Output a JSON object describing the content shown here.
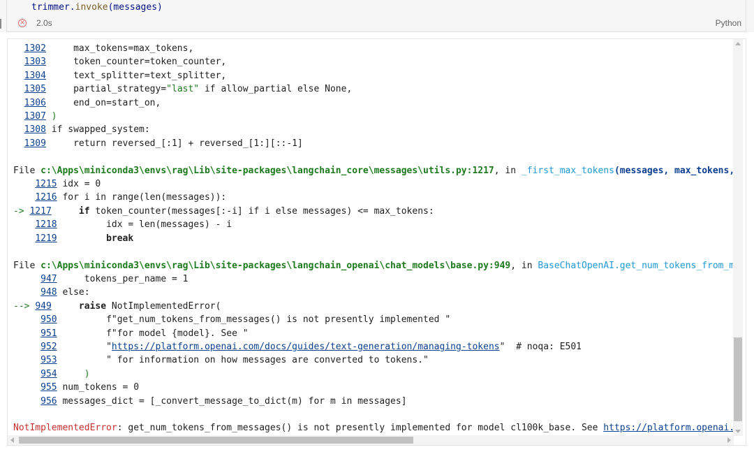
{
  "cell": {
    "code_obj": "trimmer",
    "code_dot": ".",
    "code_fn": "invoke",
    "code_open": "(",
    "code_arg": "messages",
    "code_close": ")",
    "status_icon": "error-circle-icon",
    "duration": "2.0s",
    "language": "Python"
  },
  "traceback": {
    "block1": [
      {
        "num": "1302",
        "code": "    max_tokens=max_tokens,"
      },
      {
        "num": "1303",
        "code": "    token_counter=token_counter,"
      },
      {
        "num": "1304",
        "code": "    text_splitter=text_splitter,"
      },
      {
        "num": "1305",
        "code_a": "    partial_strategy=",
        "str": "\"last\"",
        "code_b": " if allow_partial else None,"
      },
      {
        "num": "1306",
        "code": "    end_on=start_on,"
      },
      {
        "num": "1307",
        "code": ")"
      },
      {
        "num": "1308",
        "code": "if swapped_system:"
      },
      {
        "num": "1309",
        "code": "    return reversed_[:1] + reversed_[1:][::-1]"
      }
    ],
    "file2": {
      "prefix": "File ",
      "path": "c:\\Apps\\miniconda3\\envs\\rag\\Lib\\site-packages\\langchain_core\\messages\\utils.py:1217",
      "in": ", in ",
      "func": "_first_max_tokens",
      "args": "(messages, max_tokens,"
    },
    "block2": [
      {
        "arrow": "    ",
        "num": "1215",
        "code": "idx = 0"
      },
      {
        "arrow": "    ",
        "num": "1216",
        "code": "for i in range(len(messages)):"
      },
      {
        "arrow": "-> ",
        "num": "1217",
        "kw": "    if",
        "code": " token_counter(messages[:-i] if i else messages) <= max_tokens:"
      },
      {
        "arrow": "    ",
        "num": "1218",
        "code": "        idx = len(messages) - i"
      },
      {
        "arrow": "    ",
        "num": "1219",
        "code": "        break"
      }
    ],
    "file3": {
      "prefix": "File ",
      "path": "c:\\Apps\\miniconda3\\envs\\rag\\Lib\\site-packages\\langchain_openai\\chat_models\\base.py:949",
      "in": ", in ",
      "func": "BaseChatOpenAI.get_num_tokens_from_m"
    },
    "block3": [
      {
        "arrow": "     ",
        "num": "947",
        "code": "    tokens_per_name = 1"
      },
      {
        "arrow": "     ",
        "num": "948",
        "code": "else:"
      },
      {
        "arrow": "--> ",
        "num": "949",
        "kw": "    raise",
        "code": " NotImplementedError("
      },
      {
        "arrow": "     ",
        "num": "950",
        "code": "        f\"get_num_tokens_from_messages() is not presently implemented \""
      },
      {
        "arrow": "     ",
        "num": "951",
        "code": "        f\"for model {model}. See \""
      },
      {
        "arrow": "     ",
        "num": "952",
        "pre": "        \"",
        "link": "https://platform.openai.com/docs/guides/text-generation/managing-tokens",
        "post": "\"  # noqa: E501"
      },
      {
        "arrow": "     ",
        "num": "953",
        "code": "        \" for information on how messages are converted to tokens.\""
      },
      {
        "arrow": "     ",
        "num": "954",
        "code": "    )"
      },
      {
        "arrow": "     ",
        "num": "955",
        "code": "num_tokens = 0"
      },
      {
        "arrow": "     ",
        "num": "956",
        "code": "messages_dict = [_convert_message_to_dict(m) for m in messages]"
      }
    ],
    "error": {
      "name": "NotImplementedError",
      "message": ": get_num_tokens_from_messages() is not presently implemented for model cl100k_base. See ",
      "link": "https://platform.openai."
    }
  },
  "colors": {
    "line_number": "#0b3f8f",
    "path": "#1f7a1f",
    "function": "#1f9ad6",
    "error": "#c72e2e"
  }
}
